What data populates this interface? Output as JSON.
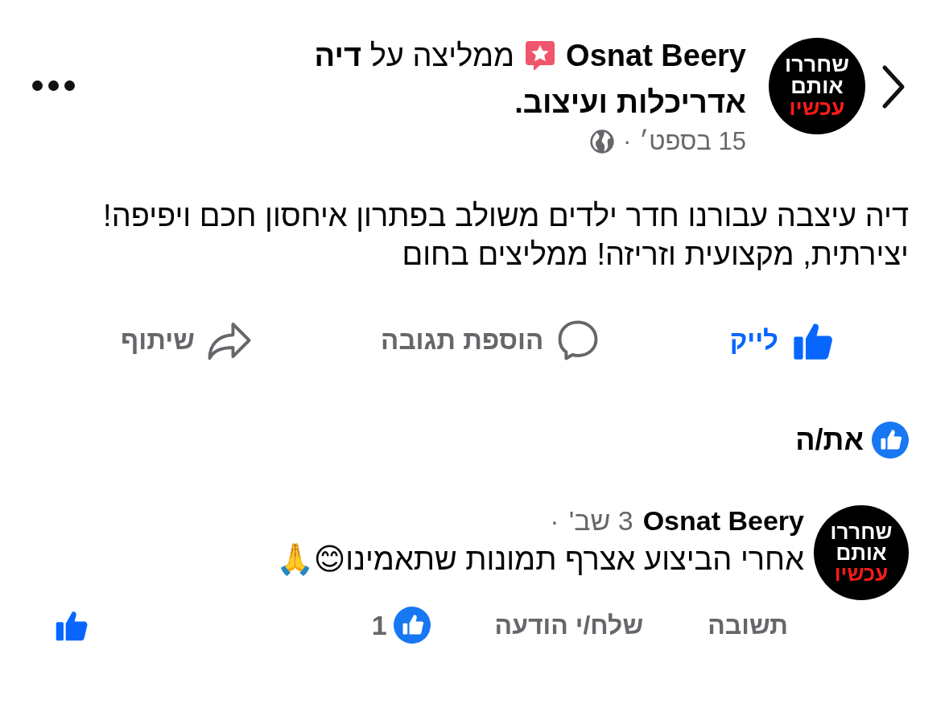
{
  "post": {
    "avatar_lines": [
      {
        "text": "שחררו",
        "color": "#ffffff"
      },
      {
        "text": "אותם",
        "color": "#ffffff"
      },
      {
        "text": "עכשיו",
        "color": "#ff1a1a"
      }
    ],
    "author": "Osnat Beery",
    "recommends_lines": [
      "ממליצה על **דיה**",
      "**אדריכלות ועיצוב.**"
    ],
    "date": "15 בספט׳",
    "separator": "·",
    "body": "דיה עיצבה עבורנו חדר ילדים משולב בפתרון איחסון חכם ויפיפה! יצירתית, מקצועית וזריזה! ממליצים בחום"
  },
  "actions": [
    {
      "kind": "like",
      "label": "לייק",
      "selected": true
    },
    {
      "kind": "comment",
      "label": "הוספת תגובה",
      "selected": false
    },
    {
      "kind": "share",
      "label": "שיתוף",
      "selected": false
    }
  ],
  "reactions": {
    "label": "את/ה"
  },
  "comment": {
    "avatar_lines": [
      {
        "text": "שחררו",
        "color": "#ffffff"
      },
      {
        "text": "אותם",
        "color": "#ffffff"
      },
      {
        "text": "עכשיו",
        "color": "#ff1a1a"
      }
    ],
    "author": "Osnat Beery",
    "time": "3 שב'",
    "separator": "·",
    "text": "אחרי הביצוע אצרף תמונות שתאמינו😊🙏",
    "actions": [
      "תשובה",
      "שלח/י הודעה"
    ],
    "like_count": "1",
    "liked": true
  }
}
